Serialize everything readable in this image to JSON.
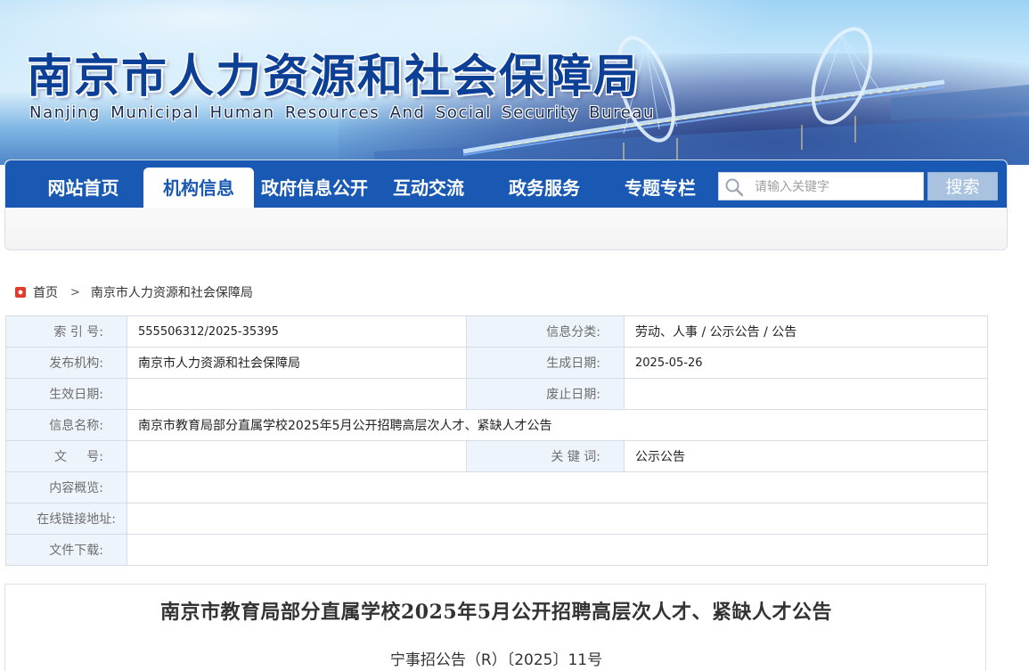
{
  "header": {
    "title": "南京市人力资源和社会保障局",
    "subtitle": "Nanjing Municipal Human Resources And Social Security Bureau"
  },
  "nav": {
    "items": [
      {
        "label": "网站首页",
        "active": false
      },
      {
        "label": "机构信息",
        "active": true
      },
      {
        "label": "政府信息公开",
        "active": false
      },
      {
        "label": "互动交流",
        "active": false
      },
      {
        "label": "政务服务",
        "active": false
      },
      {
        "label": "专题专栏",
        "active": false
      }
    ],
    "search_placeholder": "请输入关键字",
    "search_button": "搜索"
  },
  "breadcrumb": {
    "home": "首页",
    "separator": ">",
    "current": "南京市人力资源和社会保障局"
  },
  "meta": {
    "index_label": "索 引 号:",
    "index_value": "555506312/2025-35395",
    "category_label": "信息分类:",
    "category_value": "劳动、人事 / 公示公告 / 公告",
    "publisher_label": "发布机构:",
    "publisher_value": "南京市人力资源和社会保障局",
    "created_label": "生成日期:",
    "created_value": "2025-05-26",
    "effective_label": "生效日期:",
    "effective_value": "",
    "abolish_label": "废止日期:",
    "abolish_value": "",
    "name_label": "信息名称:",
    "name_value": "南京市教育局部分直属学校2025年5月公开招聘高层次人才、紧缺人才公告",
    "docno_label": "文     号:",
    "docno_value": "",
    "keywords_label": "关 键 词:",
    "keywords_value": "公示公告",
    "summary_label": "内容概览:",
    "summary_value": "",
    "link_label": "在线链接地址:",
    "link_value": "",
    "download_label": "文件下载:",
    "download_value": ""
  },
  "article": {
    "title": "南京市教育局部分直属学校2025年5月公开招聘高层次人才、紧缺人才公告",
    "doc_number": "宁事招公告（R）〔2025〕11号"
  },
  "colors": {
    "nav_blue": "#1a59b3",
    "title_blue": "#0c3f96",
    "label_bg": "#eef4fb",
    "search_button_bg": "#a9c2df",
    "breadcrumb_icon_red": "#e23b2b"
  }
}
